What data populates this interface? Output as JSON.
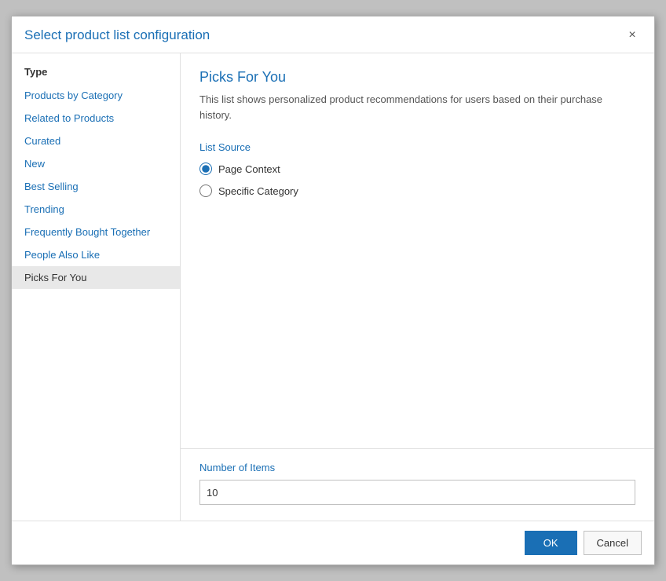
{
  "dialog": {
    "title": "Select product list configuration",
    "close_label": "×"
  },
  "sidebar": {
    "header": "Type",
    "items": [
      {
        "label": "Products by Category",
        "active": false
      },
      {
        "label": "Related to Products",
        "active": false
      },
      {
        "label": "Curated",
        "active": false
      },
      {
        "label": "New",
        "active": false
      },
      {
        "label": "Best Selling",
        "active": false
      },
      {
        "label": "Trending",
        "active": false
      },
      {
        "label": "Frequently Bought Together",
        "active": false
      },
      {
        "label": "People Also Like",
        "active": false
      },
      {
        "label": "Picks For You",
        "active": true
      }
    ]
  },
  "main": {
    "title": "Picks For You",
    "description": "This list shows personalized product recommendations for users based on their purchase history.",
    "list_source_label": "List Source",
    "radio_options": [
      {
        "label": "Page Context",
        "checked": true
      },
      {
        "label": "Specific Category",
        "checked": false
      }
    ],
    "number_of_items_label": "Number of Items",
    "number_of_items_value": "10"
  },
  "footer": {
    "ok_label": "OK",
    "cancel_label": "Cancel"
  }
}
